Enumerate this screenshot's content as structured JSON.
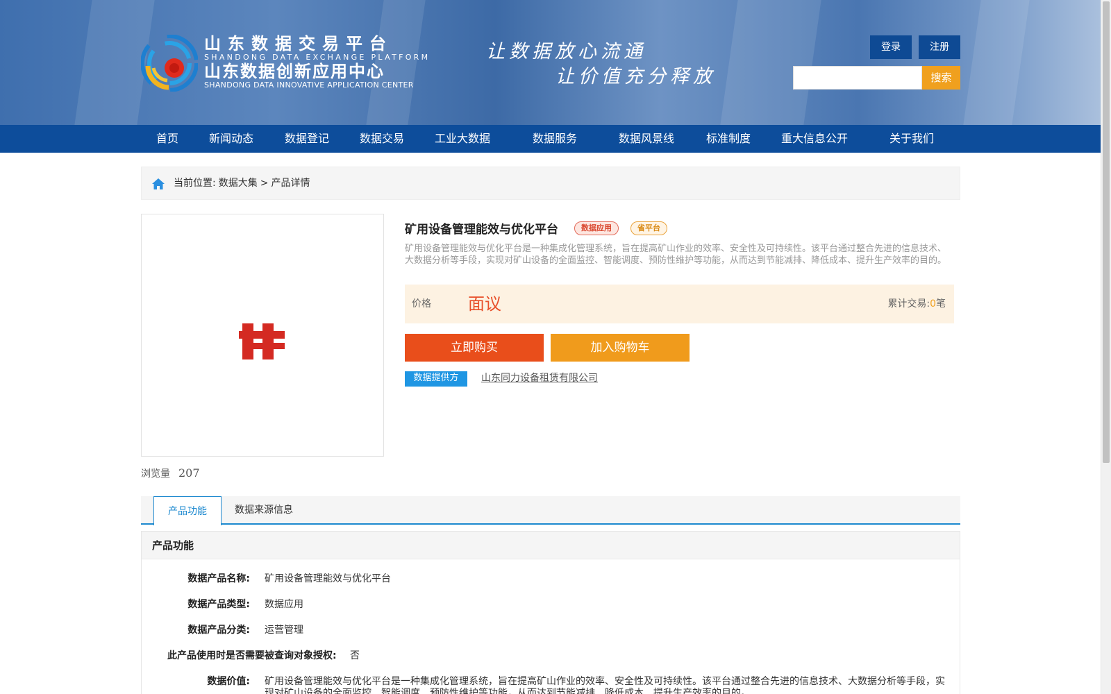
{
  "header": {
    "brand_cn1": "山东数据交易平台",
    "brand_en1": "SHANDONG DATA EXCHANGE PLATFORM",
    "brand_cn2": "山东数据创新应用中心",
    "brand_en2": "SHANDONG DATA INNOVATIVE APPLICATION CENTER",
    "slogan_line1": "让数据放心流通",
    "slogan_line2": "让价值充分释放",
    "login_label": "登录",
    "register_label": "注册",
    "search_placeholder": "",
    "search_label": "搜索"
  },
  "nav": {
    "items": [
      "首页",
      "新闻动态",
      "数据登记",
      "数据交易",
      "工业大数据",
      "数据服务",
      "数据风景线",
      "标准制度",
      "重大信息公开",
      "关于我们"
    ]
  },
  "breadcrumb": {
    "prefix": "当前位置:",
    "level1": "数据大集",
    "separator": ">",
    "level2": "产品详情"
  },
  "product": {
    "title": "矿用设备管理能效与优化平台",
    "tag_type": "数据应用",
    "tag_platform": "省平台",
    "description": "矿用设备管理能效与优化平台是一种集成化管理系统，旨在提高矿山作业的效率、安全性及可持续性。该平台通过整合先进的信息技术、大数据分析等手段，实现对矿山设备的全面监控、智能调度、预防性维护等功能，从而达到节能减排、降低成本、提升生产效率的目的。",
    "price_label": "价格",
    "price_value": "面议",
    "trade_prefix": "累计交易:",
    "trade_count": "0",
    "trade_suffix": "笔",
    "buy_label": "立即购买",
    "cart_label": "加入购物车",
    "provider_label": "数据提供方",
    "provider_name": "山东同力设备租赁有限公司",
    "views_label": "浏览量",
    "views_count": "207"
  },
  "tabs": [
    "产品功能",
    "数据来源信息"
  ],
  "section": {
    "title": "产品功能",
    "rows": [
      {
        "label": "数据产品名称:",
        "value": "矿用设备管理能效与优化平台"
      },
      {
        "label": "数据产品类型:",
        "value": "数据应用"
      },
      {
        "label": "数据产品分类:",
        "value": "运营管理"
      },
      {
        "label": "此产品使用时是否需要被查询对象授权:",
        "value": "否"
      },
      {
        "label": "数据价值:",
        "value": "矿用设备管理能效与优化平台是一种集成化管理系统，旨在提高矿山作业的效率、安全性及可持续性。该平台通过整合先进的信息技术、大数据分析等手段，实现对矿山设备的全面监控、智能调度、预防性维护等功能，从而达到节能减排、降低成本、提升生产效率的目的。"
      }
    ]
  },
  "colors": {
    "nav_bg": "#0d4d9b",
    "accent_orange": "#f0a01e",
    "buy_red": "#e94e1b",
    "price_red": "#e8502b",
    "tab_blue": "#1d89cf"
  }
}
